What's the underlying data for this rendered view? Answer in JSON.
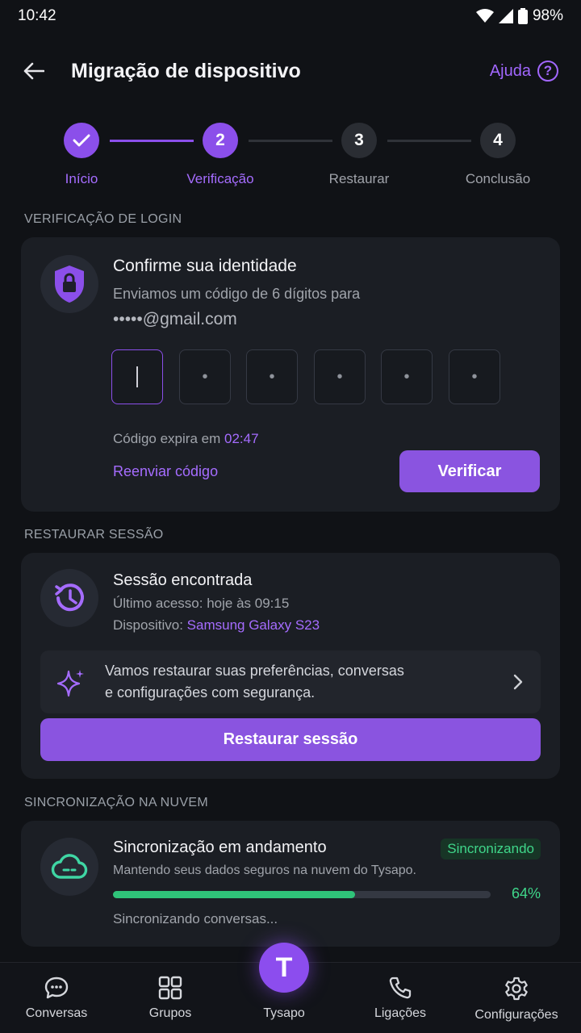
{
  "status": {
    "time": "10:42",
    "battery": "98%"
  },
  "appbar": {
    "title": "Migração de dispositivo",
    "help_label": "Ajuda"
  },
  "stepper": {
    "steps": [
      {
        "number": "",
        "label": "Início",
        "state": "done"
      },
      {
        "number": "2",
        "label": "Verificação",
        "state": "active"
      },
      {
        "number": "3",
        "label": "Restaurar",
        "state": "pending"
      },
      {
        "number": "4",
        "label": "Conclusão",
        "state": "pending"
      }
    ]
  },
  "login": {
    "section_title": "VERIFICAÇÃO DE LOGIN",
    "heading": "Confirme sua identidade",
    "subtitle": "Enviamos um código de 6 dígitos para",
    "email": "•••••@gmail.com",
    "code_digits": [
      "",
      "•",
      "•",
      "•",
      "•",
      "•"
    ],
    "expires_label": "Código expira em",
    "expires_time": "02:47",
    "resend_label": "Reenviar código",
    "verify_label": "Verificar"
  },
  "session": {
    "section_title": "RESTAURAR SESSÃO",
    "heading": "Sessão encontrada",
    "last_access": "Último acesso: hoje às 09:15",
    "device_label": "Dispositivo:",
    "device_name": "Samsung Galaxy S23",
    "info_line1": "Vamos restaurar suas preferências, conversas",
    "info_line2": "e configurações com segurança.",
    "restore_label": "Restaurar sessão"
  },
  "sync": {
    "section_title": "SINCRONIZAÇÃO NA NUVEM",
    "heading": "Sincronização em andamento",
    "badge": "Sincronizando",
    "description": "Mantendo seus dados seguros na nuvem do Tysapo.",
    "progress_percent": 64,
    "progress_label": "64%",
    "status_text": "Sincronizando conversas..."
  },
  "nav": {
    "items": [
      {
        "label": "Conversas"
      },
      {
        "label": "Grupos"
      },
      {
        "label": "Tysapo"
      },
      {
        "label": "Ligações"
      },
      {
        "label": "Configurações"
      }
    ],
    "fab_letter": "T"
  },
  "colors": {
    "accent": "#8b4fea",
    "success": "#2fc379",
    "background": "#101216",
    "card": "#1b1e24"
  }
}
